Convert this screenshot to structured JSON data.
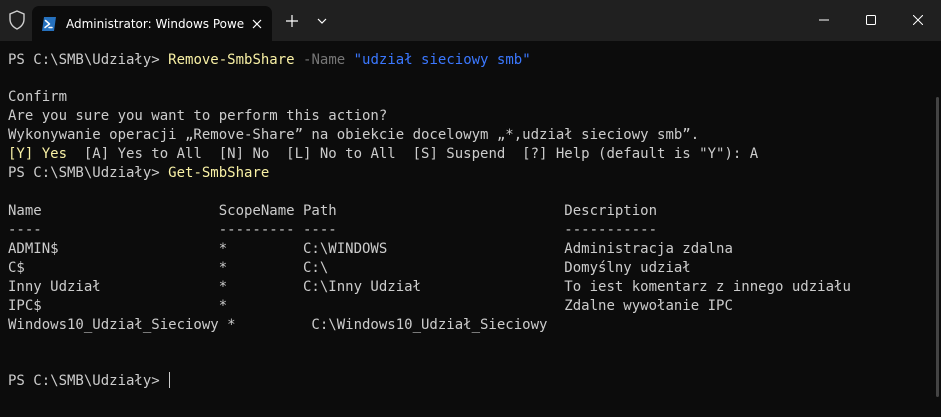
{
  "window": {
    "tab_title": "Administrator: Windows PowerShell",
    "icons": {
      "shield": "shield-icon",
      "tab": "powershell-icon",
      "close_tab": "close-icon",
      "new_tab": "plus-icon",
      "dropdown": "chevron-down-icon",
      "minimize": "minimize-icon",
      "maximize": "maximize-icon",
      "close": "close-icon"
    }
  },
  "colors": {
    "background": "#0c0c0c",
    "text": "#cccccc",
    "command": "#f9f1a5",
    "parameter": "#767676",
    "string": "#3b78ff"
  },
  "terminal": {
    "prompt": "PS C:\\SMB\\Udziały> ",
    "cmd1": {
      "name": "Remove-SmbShare",
      "param": "-Name",
      "value": "\"udział sieciowy smb\""
    },
    "confirm_title": "Confirm",
    "confirm_question": "Are you sure you want to perform this action?",
    "confirm_detail": "Wykonywanie operacji „Remove-Share” na obiekcie docelowym „*,udział sieciowy smb”.",
    "choices": {
      "yes": "[Y] Yes",
      "rest": "  [A] Yes to All  [N] No  [L] No to All  [S] Suspend  [?] Help (default is \"Y\"): A"
    },
    "cmd2": {
      "name": "Get-SmbShare"
    },
    "table": {
      "header": "Name                     ScopeName Path                           Description",
      "separator": "----                     --------- ----                           -----------",
      "rows": [
        "ADMIN$                   *         C:\\WINDOWS                     Administracja zdalna",
        "C$                       *         C:\\                            Domyślny udział",
        "Inny Udział              *         C:\\Inny Udział                 To iest komentarz z innego udziału",
        "IPC$                     *                                        Zdalne wywołanie IPC",
        "Windows10_Udział_Sieciowy *         C:\\Windows10_Udział_Sieciowy"
      ]
    }
  }
}
